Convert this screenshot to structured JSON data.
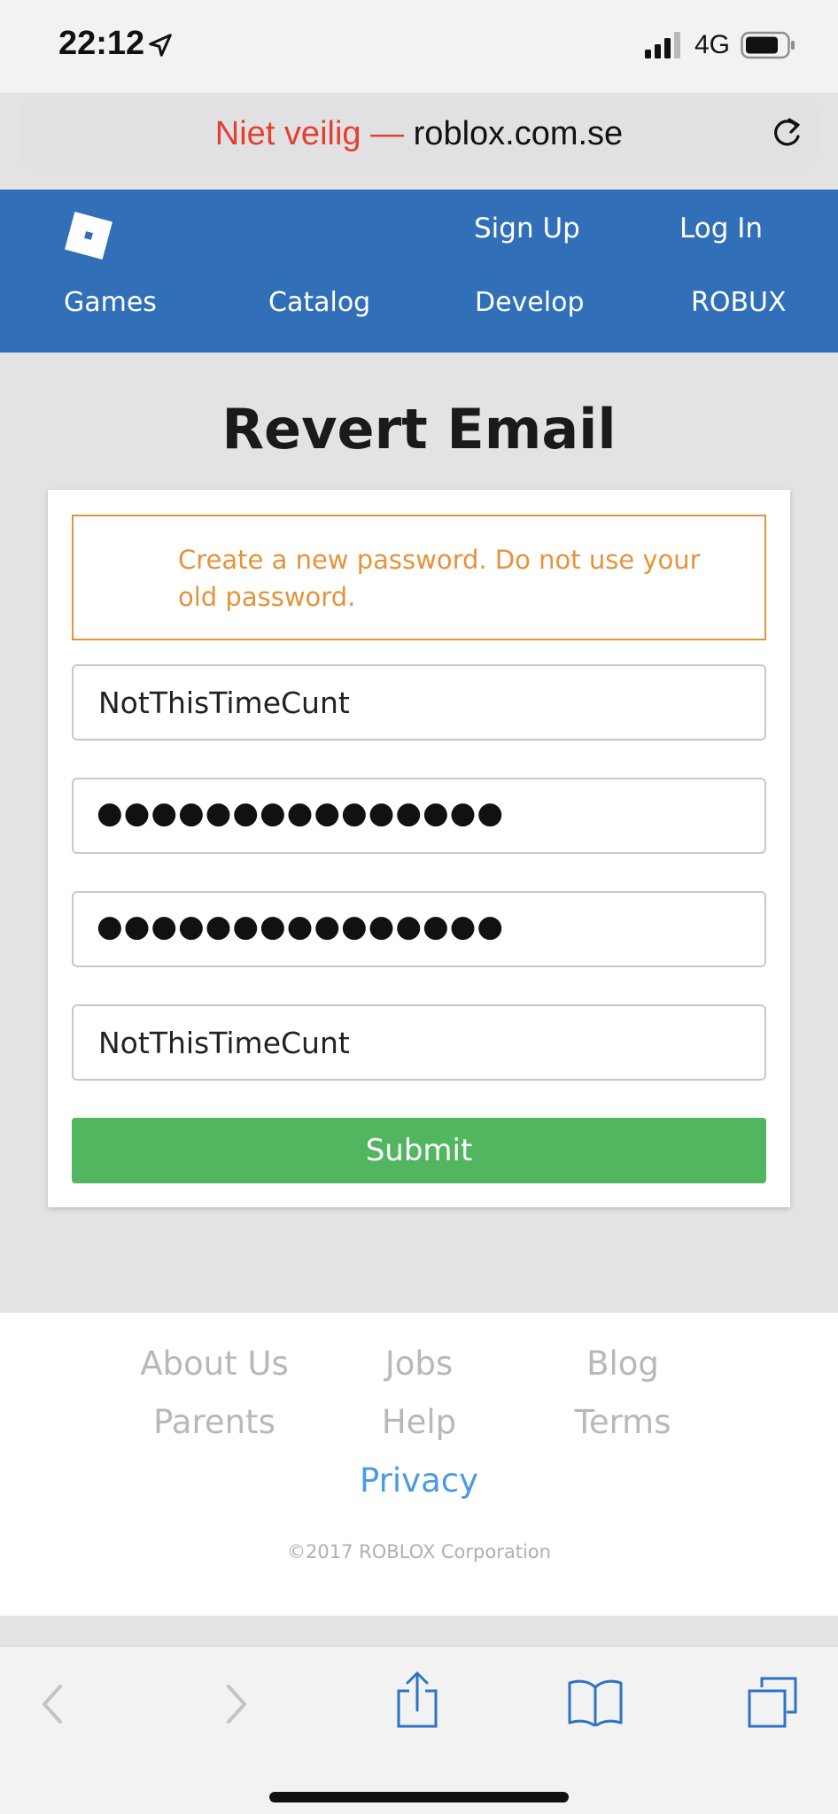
{
  "status_bar": {
    "time": "22:12",
    "network": "4G",
    "icons": [
      "location-arrow-icon",
      "signal-bars-icon",
      "battery-icon"
    ]
  },
  "url_bar": {
    "insecure_label": "Niet veilig —",
    "domain": "roblox.com.se",
    "insecure_color": "#e3402f"
  },
  "nav": {
    "sign_up": "Sign Up",
    "log_in": "Log In",
    "items": [
      {
        "label": "Games"
      },
      {
        "label": "Catalog"
      },
      {
        "label": "Develop"
      },
      {
        "label": "ROBUX"
      }
    ],
    "bg_color": "#3170b8"
  },
  "main": {
    "title": "Revert Email",
    "alert": "Create a new password. Do not use your old password.",
    "fields": [
      {
        "value": "NotThisTimeCunt",
        "type": "text"
      },
      {
        "value": "●●●●●●●●●●●●●●●",
        "type": "password"
      },
      {
        "value": "●●●●●●●●●●●●●●●",
        "type": "password"
      },
      {
        "value": "NotThisTimeCunt",
        "type": "text"
      }
    ],
    "submit_label": "Submit",
    "submit_color": "#52b560",
    "alert_color": "#e5933b"
  },
  "footer": {
    "links": [
      {
        "label": "About Us"
      },
      {
        "label": "Jobs"
      },
      {
        "label": "Blog"
      },
      {
        "label": "Parents"
      },
      {
        "label": "Help"
      },
      {
        "label": "Terms"
      },
      {
        "label": "Privacy"
      }
    ],
    "copyright": "©2017 ROBLOX Corporation"
  },
  "toolbar": {
    "icons": [
      "back-arrow-icon",
      "forward-arrow-icon",
      "share-icon",
      "bookmarks-icon",
      "tabs-icon"
    ]
  }
}
